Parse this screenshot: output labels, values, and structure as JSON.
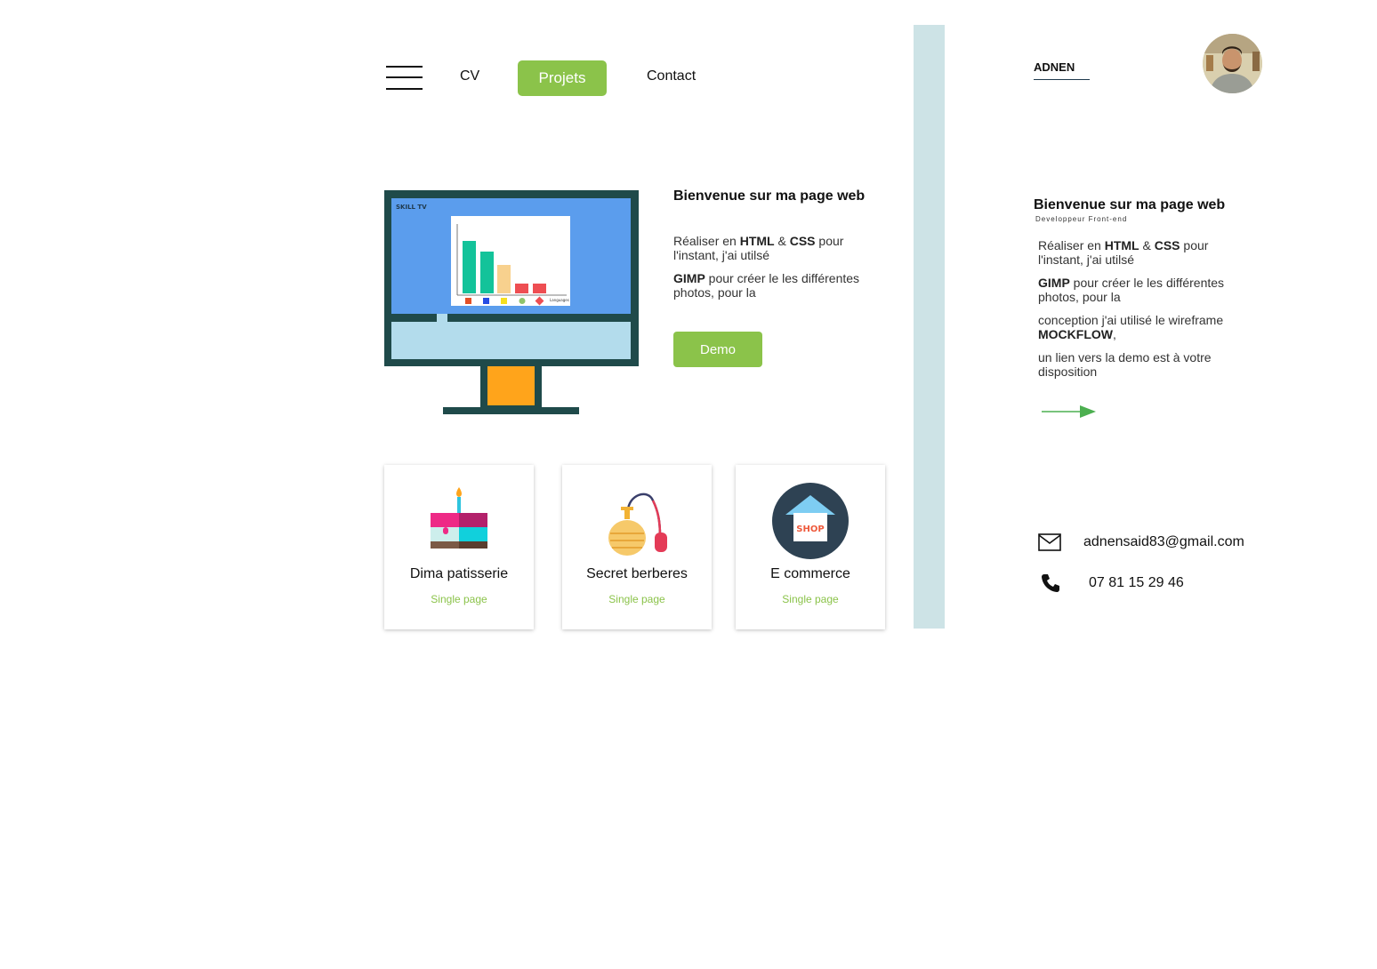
{
  "nav": {
    "items": [
      {
        "label": "CV"
      },
      {
        "label": "Projets",
        "active": true
      },
      {
        "label": "Contact"
      }
    ],
    "menu_icon": "hamburger-menu-icon",
    "active_color": "#8bc34a"
  },
  "hero": {
    "screen_label": "SKILL TV",
    "chart_caption": "Languages",
    "title": "Bienvenue sur ma page web",
    "p1_pre": "Réaliser en ",
    "p1_html": "HTML",
    "p1_amp": " & ",
    "p1_css": "CSS",
    "p1_post": " pour l'instant, j'ai utilsé",
    "p2_gimp": "GIMP",
    "p2_post": " pour créer le les différentes photos, pour la",
    "demo_label": "Demo"
  },
  "projects": [
    {
      "title": "Dima patisserie",
      "type": "Single page",
      "icon": "cake-icon"
    },
    {
      "title": "Secret berberes",
      "type": "Single page",
      "icon": "perfume-bottle-icon"
    },
    {
      "title": "E commerce",
      "type": "Single page",
      "icon": "shop-icon",
      "icon_text": "SHOP"
    }
  ],
  "sidebar": {
    "brand": "ADNEN",
    "title": "Bienvenue sur ma page web",
    "subtitle": "Developpeur Front-end",
    "p1_pre": "Réaliser en ",
    "p1_html": "HTML",
    "p1_amp": " & ",
    "p1_css": "CSS",
    "p1_post": " pour l'instant, j'ai utilsé",
    "p2_gimp": "GIMP",
    "p2_post": " pour créer le les différentes photos, pour la",
    "p3_pre": "conception j'ai utilisé le wireframe ",
    "p3_bold": "MOCKFLOW",
    "p3_post": ",",
    "p4": "un lien vers la demo est à votre disposition",
    "email": "adnensaid83@gmail.com",
    "phone": "07 81 15 29 46"
  },
  "colors": {
    "accent": "#8bc34a",
    "divider_bar": "#cde3e6",
    "monitor_frame": "#1f4a4a",
    "monitor_screen": "#5b9ded"
  }
}
